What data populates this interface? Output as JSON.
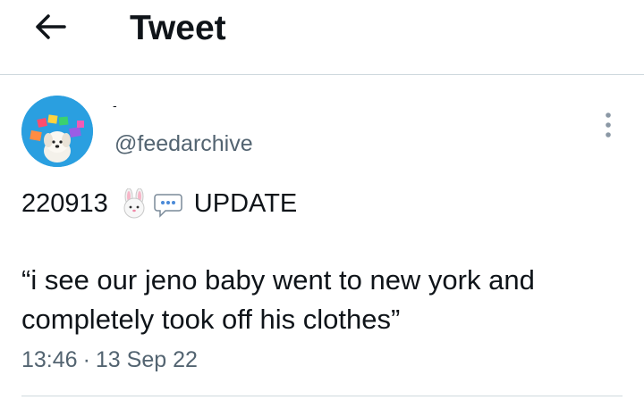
{
  "header": {
    "title": "Tweet",
    "back_icon": "arrow-left-icon"
  },
  "tweet": {
    "display_name": "-",
    "handle": "@feedarchive",
    "avatar_icon": "dream-logo-puppy-avatar",
    "text_line1_date": "220913",
    "text_line1_emojis": [
      "rabbit-face-emoji",
      "speech-bubble-emoji"
    ],
    "text_line1_tag": "UPDATE",
    "quote_line1": "“i see our jeno baby went to new york and",
    "quote_line2": "completely took off his clothes”",
    "time": "13:46",
    "separator": "·",
    "date": "13 Sep 22",
    "more_icon": "more-vertical-icon"
  },
  "colors": {
    "text": "#0f1419",
    "secondary": "#536471",
    "divider": "#cfd9de",
    "avatar_bg": "#2a9fe0"
  }
}
